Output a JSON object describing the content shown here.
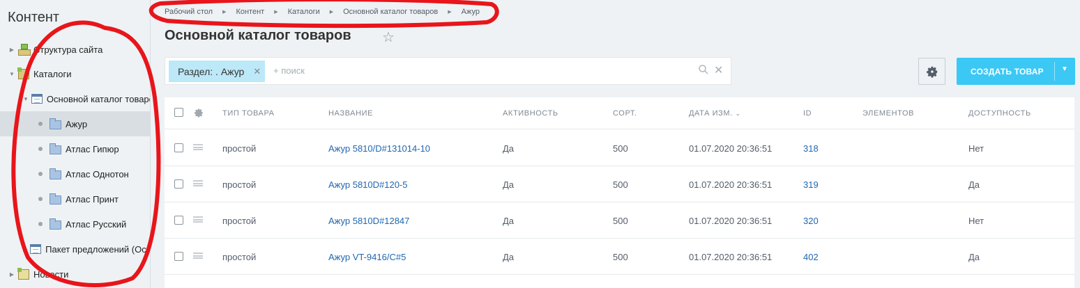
{
  "sidebar": {
    "title": "Контент",
    "items": [
      {
        "label": "Структура сайта"
      },
      {
        "label": "Каталоги"
      },
      {
        "label": "Основной каталог товаров"
      },
      {
        "label": "Ажур"
      },
      {
        "label": "Атлас Гипюр"
      },
      {
        "label": "Атлас Однотон"
      },
      {
        "label": "Атлас Принт"
      },
      {
        "label": "Атлас Русский"
      },
      {
        "label": "Пакет предложений (Основной каталог товаров)"
      },
      {
        "label": "Новости"
      }
    ]
  },
  "breadcrumb": [
    "Рабочий стол",
    "Контент",
    "Каталоги",
    "Основной каталог товаров",
    "Ажур"
  ],
  "page": {
    "title": "Основной каталог товаров"
  },
  "filter": {
    "chip": "Раздел: . Ажур",
    "placeholder": "+ поиск"
  },
  "toolbar": {
    "create_label": "СОЗДАТЬ ТОВАР"
  },
  "grid": {
    "columns": [
      "ТИП ТОВАРА",
      "НАЗВАНИЕ",
      "АКТИВНОСТЬ",
      "СОРТ.",
      "ДАТА ИЗМ.",
      "ID",
      "ЭЛЕМЕНТОВ",
      "ДОСТУПНОСТЬ"
    ],
    "rows": [
      {
        "type": "простой",
        "name": "Ажур 5810/D#131014-10",
        "active": "Да",
        "sort": "500",
        "date": "01.07.2020 20:36:51",
        "id": "318",
        "elements": "",
        "available": "Нет"
      },
      {
        "type": "простой",
        "name": "Ажур 5810D#120-5",
        "active": "Да",
        "sort": "500",
        "date": "01.07.2020 20:36:51",
        "id": "319",
        "elements": "",
        "available": "Да"
      },
      {
        "type": "простой",
        "name": "Ажур 5810D#12847",
        "active": "Да",
        "sort": "500",
        "date": "01.07.2020 20:36:51",
        "id": "320",
        "elements": "",
        "available": "Нет"
      },
      {
        "type": "простой",
        "name": "Ажур VT-9416/C#5",
        "active": "Да",
        "sort": "500",
        "date": "01.07.2020 20:36:51",
        "id": "402",
        "elements": "",
        "available": "Да"
      }
    ]
  },
  "colors": {
    "accent": "#3bc8f5",
    "link": "#2067b0",
    "chip": "#bde8f7"
  }
}
